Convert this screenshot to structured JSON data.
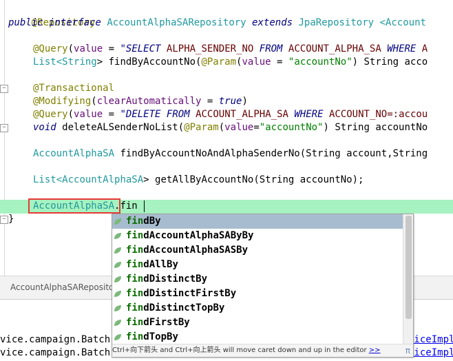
{
  "code": {
    "l1": "@Repository",
    "l2_public": "public",
    "l2_interface": "interface",
    "l2_name": "AccountAlphaSARepository",
    "l2_extends": "extends",
    "l2_rest": "JpaRepository <Account",
    "l3_ann": "@Query",
    "l3_p1": "(",
    "l3_value": "value",
    "l3_eq": " = ",
    "l3_q": "\"SELECT ",
    "l3_t1": "ALPHA_SENDER_NO",
    "l3_from": " FROM ",
    "l3_t2": "ACCOUNT_ALPHA_SA",
    "l3_where": " WHERE ",
    "l3_t3": "A",
    "l4_list": "List<",
    "l4_string": "String",
    "l4_gt": "> findByAccountNo(",
    "l4_param": "@Param",
    "l4_p": "(",
    "l4_value": "value",
    "l4_eq": " = ",
    "l4_str": "\"accountNo\"",
    "l4_rest": ") String acco",
    "l5": "@Transactional",
    "l6_ann": "@Modifying",
    "l6_p": "(",
    "l6_attr": "clearAutomatically",
    "l6_eq": " = ",
    "l6_true": "true",
    "l6_close": ")",
    "l7_ann": "@Query",
    "l7_p": "(",
    "l7_value": "value",
    "l7_eq": " = ",
    "l7_q": "\"DELETE ",
    "l7_from": "FROM ",
    "l7_t1": "ACCOUNT_ALPHA_SA",
    "l7_where": " WHERE ",
    "l7_t2": "ACCOUNT_NO=:accou",
    "l8_void": "void",
    "l8_name": " deleteALSenderNoList(",
    "l8_param": "@Param",
    "l8_p": "(",
    "l8_value": "value",
    "l8_eq": "=",
    "l8_str": "\"accountNo\"",
    "l8_rest": ") String accountNo",
    "l9_type": "AccountAlphaSA",
    "l9_rest": " findByAccountNoAndAlphaSenderNo(String account,String",
    "l10_list": "List<",
    "l10_type": "AccountAlphaSA",
    "l10_rest": "> getAllByAccountNo(String accountNo);",
    "l11_type": "AccountAlphaSA",
    "l11_rest": ".fin",
    "l12": "}"
  },
  "breadcrumb": "AccountAlphaSARepository",
  "console": {
    "c1_left": "vice.campaign.Batch",
    "c1_right": "viceImpl",
    "c2_left": "vice.campaign.Batch",
    "c2_right": "viceImpl"
  },
  "completion": {
    "prefix": "fin",
    "items": [
      {
        "match": "fin",
        "rest": "dBy"
      },
      {
        "match": "fin",
        "rest": "dAccountAlphaSAByBy"
      },
      {
        "match": "fin",
        "rest": "dAccountAlphaSASBy"
      },
      {
        "match": "fin",
        "rest": "dAllBy"
      },
      {
        "match": "fin",
        "rest": "dDistinctBy"
      },
      {
        "match": "fin",
        "rest": "dDistinctFirstBy"
      },
      {
        "match": "fin",
        "rest": "dDistinctTopBy"
      },
      {
        "match": "fin",
        "rest": "dFirstBy"
      },
      {
        "match": "fin",
        "rest": "dTopBy"
      }
    ],
    "hint": "Ctrl+向下箭头 and Ctrl+向上箭头 will move caret down and up in the editor",
    "hint_link": ">>",
    "hint_pi": "π"
  },
  "colors": {
    "selection": "#a8bccf",
    "line_highlight": "#a6f2c0",
    "focus_box": "#e53935"
  }
}
